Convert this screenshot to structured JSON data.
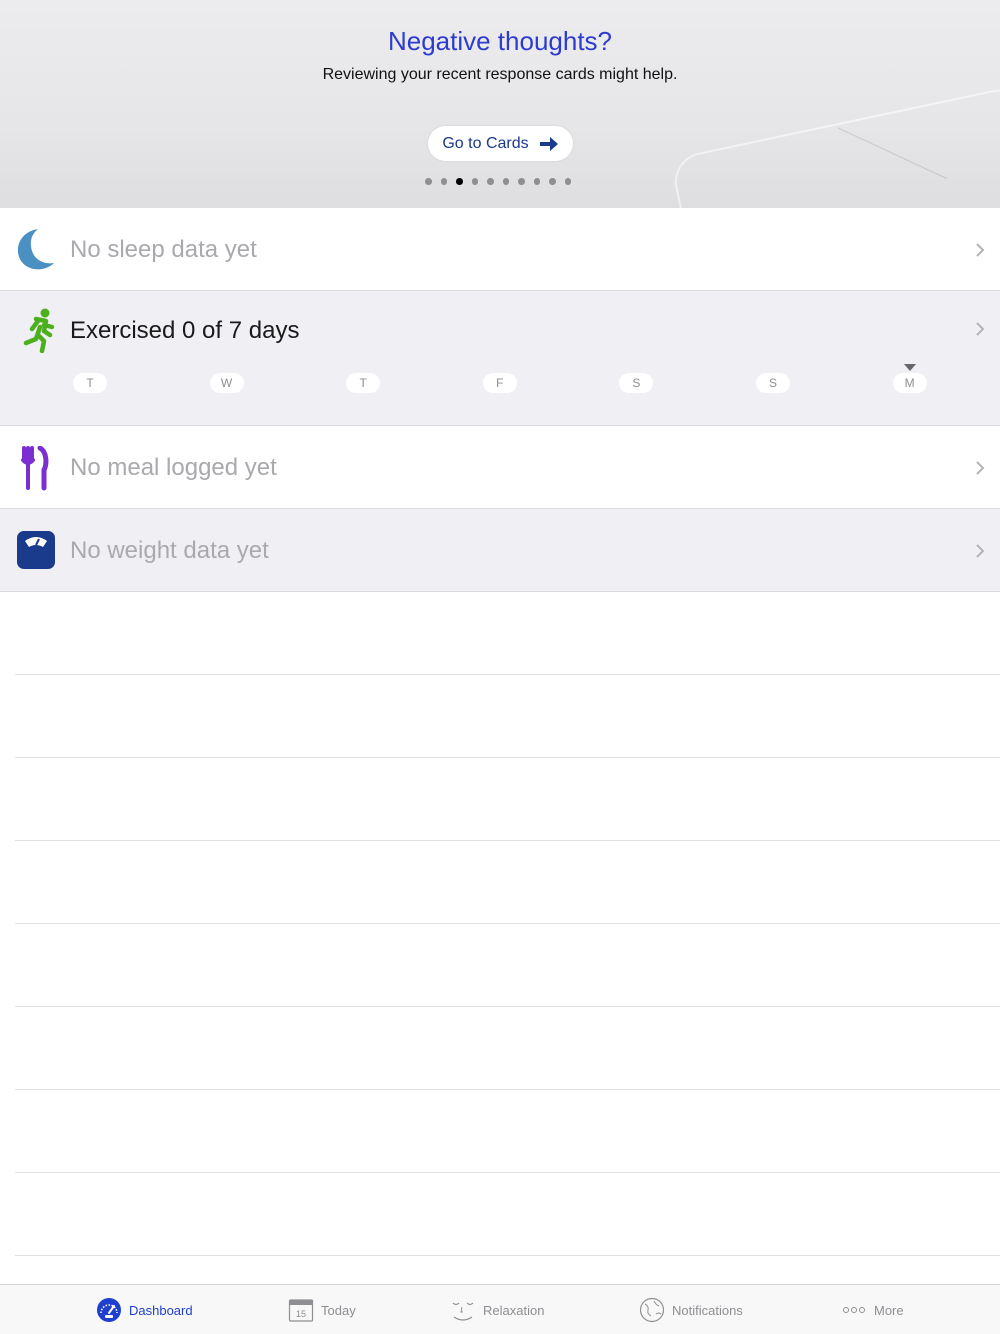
{
  "banner": {
    "title": "Negative thoughts?",
    "subtitle": "Reviewing your recent response cards might help.",
    "button_label": "Go to Cards",
    "page_count": 10,
    "active_page": 3
  },
  "rows": {
    "sleep": {
      "label": "No sleep data yet"
    },
    "exercise": {
      "label": "Exercised 0 of 7 days",
      "days": [
        "T",
        "W",
        "T",
        "F",
        "S",
        "S",
        "M"
      ],
      "current_day_index": 6
    },
    "meal": {
      "label": "No meal logged yet"
    },
    "weight": {
      "label": "No weight data yet"
    }
  },
  "tabbar": {
    "dashboard": "Dashboard",
    "today": "Today",
    "today_date": "15",
    "relaxation": "Relaxation",
    "notifications": "Notifications",
    "more": "More"
  },
  "colors": {
    "accent": "#1e3fd0",
    "banner_title": "#2d3ccf",
    "sleep_icon": "#4a90c2",
    "exercise_icon": "#4caf1e",
    "meal_icon": "#7b2fd0",
    "weight_icon": "#1a3a8c"
  },
  "icons": {
    "sleep": "moon-icon",
    "exercise": "running-person-icon",
    "meal": "fork-knife-icon",
    "weight": "scale-icon",
    "chevron": "chevron-right-icon"
  }
}
